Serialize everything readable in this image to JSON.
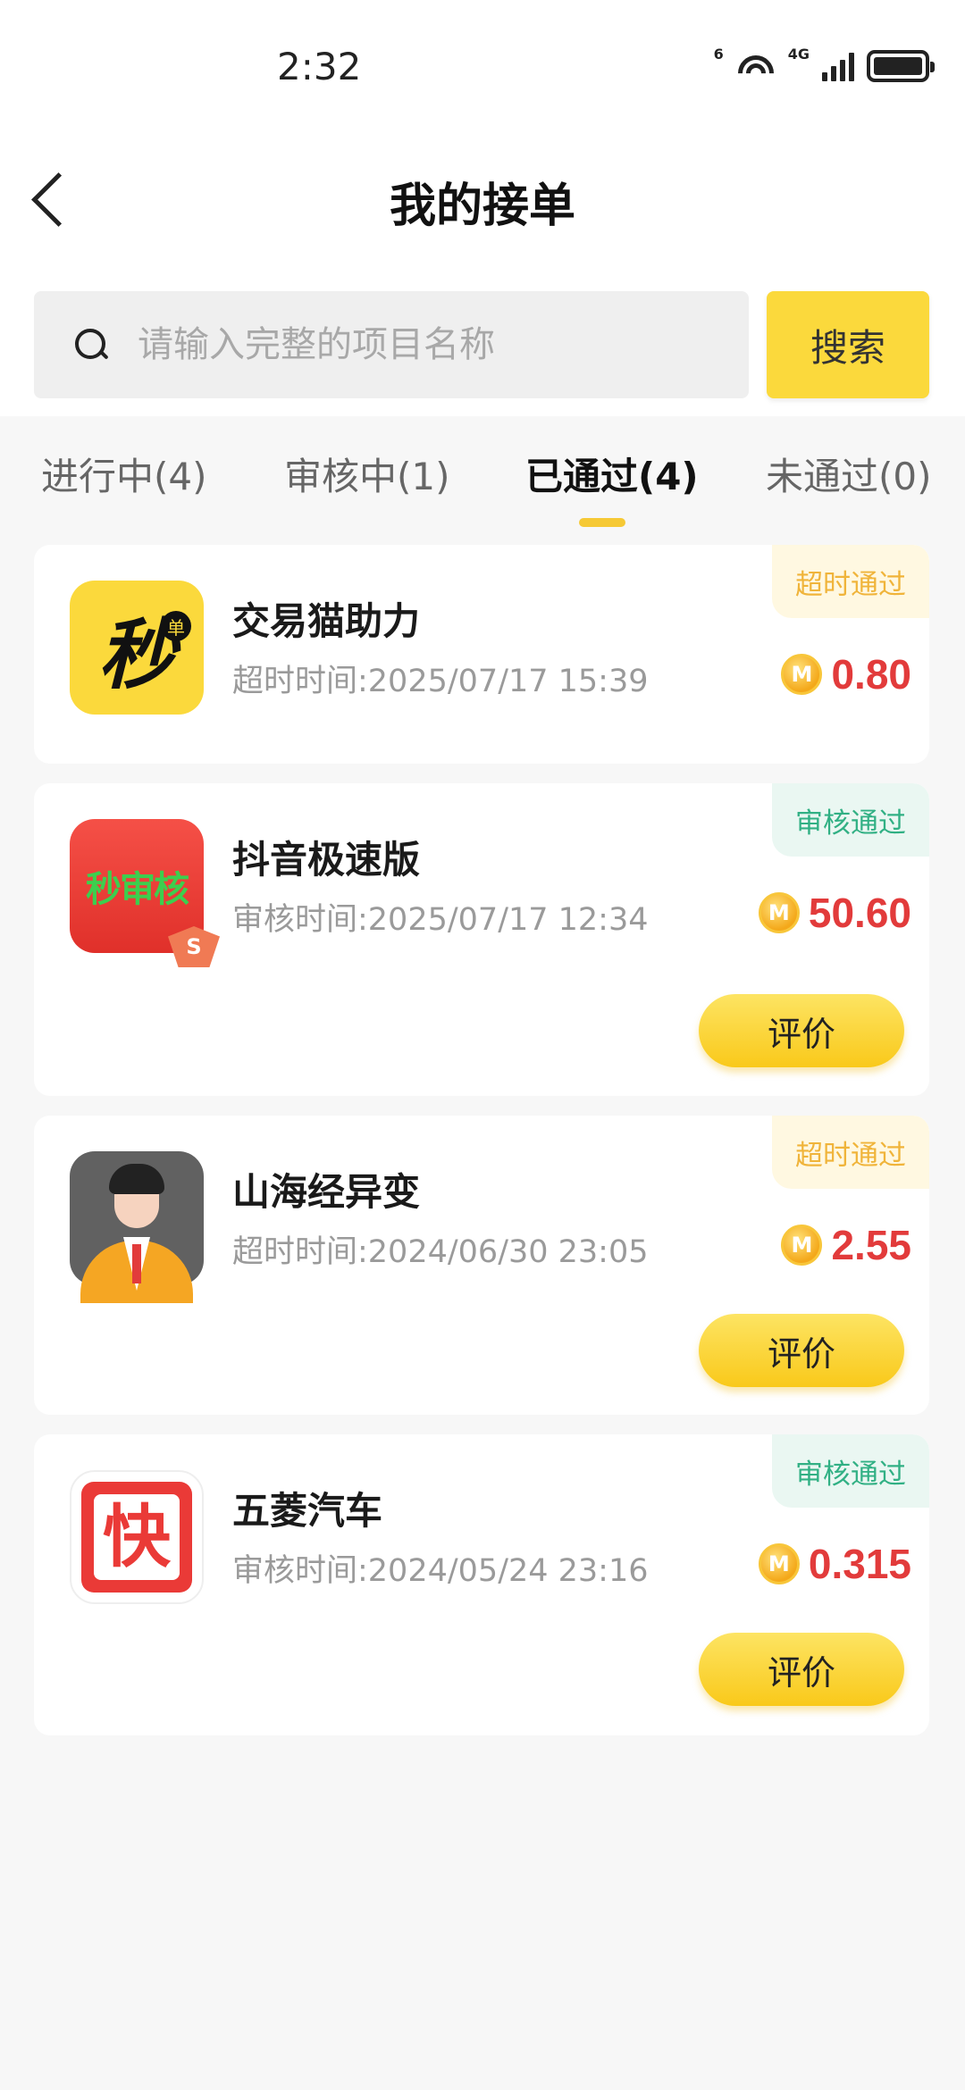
{
  "status": {
    "time": "2:32",
    "network_label": "4G",
    "wifi_label": "6"
  },
  "header": {
    "title": "我的接单"
  },
  "search": {
    "placeholder": "请输入完整的项目名称",
    "value": "",
    "button_label": "搜索"
  },
  "tabs": [
    {
      "label": "进行中(4)",
      "active": false
    },
    {
      "label": "审核中(1)",
      "active": false
    },
    {
      "label": "已通过(4)",
      "active": true
    },
    {
      "label": "未通过(0)",
      "active": false
    }
  ],
  "orders": [
    {
      "name": "交易猫助力",
      "time": "超时时间:2025/07/17 15:39",
      "badge": "超时通过",
      "badge_type": "timeout",
      "amount": "0.80",
      "icon": "miao-icon",
      "icon_text": "秒",
      "icon_sub": "单",
      "action": ""
    },
    {
      "name": "抖音极速版",
      "time": "审核时间:2025/07/17 12:34",
      "badge": "审核通过",
      "badge_type": "reviewed",
      "amount": "50.60",
      "icon": "miao-shenhe-icon",
      "icon_text": "秒审核",
      "icon_sub": "S",
      "action": "评价"
    },
    {
      "name": "山海经异变",
      "time": "超时时间:2024/06/30 23:05",
      "badge": "超时通过",
      "badge_type": "timeout",
      "amount": "2.55",
      "icon": "person-avatar-icon",
      "action": "评价"
    },
    {
      "name": "五菱汽车",
      "time": "审核时间:2024/05/24 23:16",
      "badge": "审核通过",
      "badge_type": "reviewed",
      "amount": "0.315",
      "icon": "kuai-icon",
      "icon_text": "快",
      "action": "评价"
    }
  ],
  "coin_symbol": "M",
  "colors": {
    "accent": "#fbd93c",
    "amount": "#e23b3b",
    "timeout_badge": "#f0b43a",
    "reviewed_badge": "#31b084"
  }
}
